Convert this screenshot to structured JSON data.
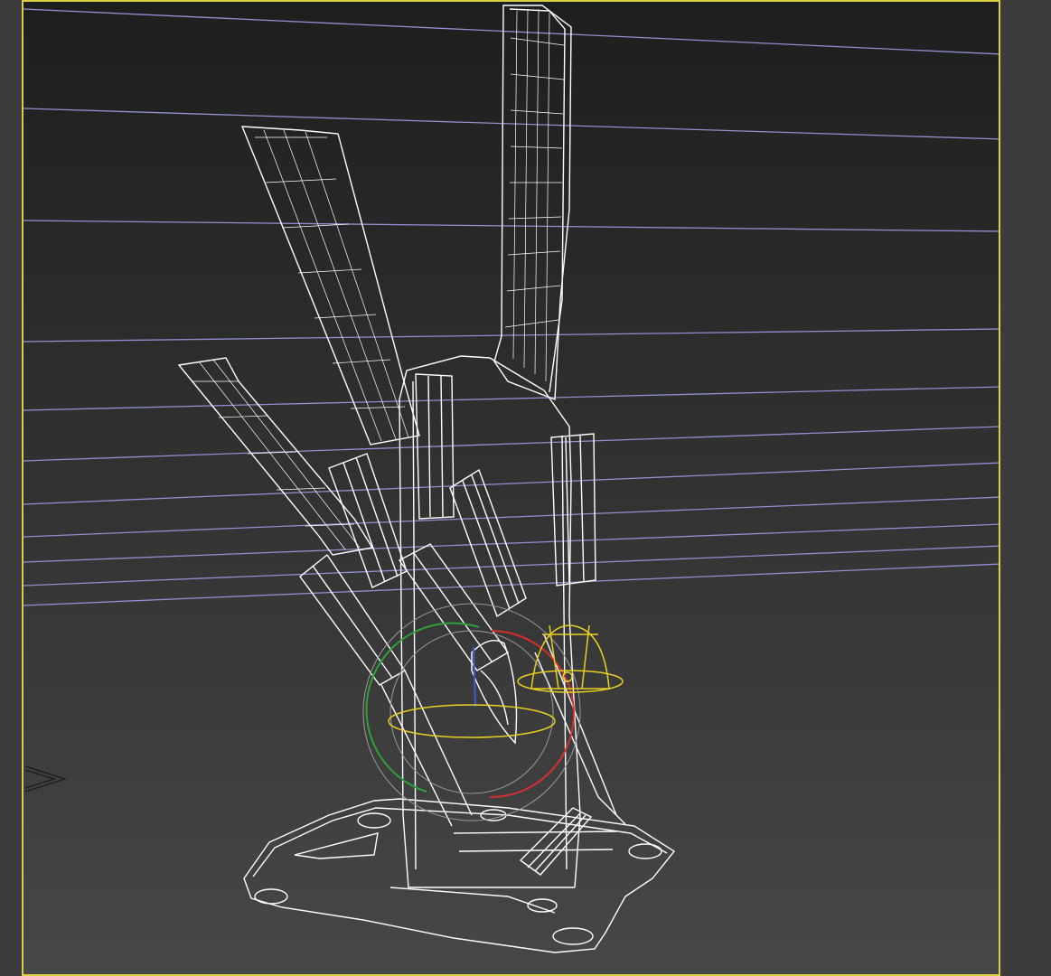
{
  "viewport": {
    "active_border_color": "#d8cf45",
    "background_top": "#1e1e1e",
    "background_bottom": "#474747",
    "wireframe_color": "#ffffff",
    "guide_line_color": "#8f8fd2"
  },
  "gizmo": {
    "rotate_x_color": "#d43030",
    "rotate_y_color": "#2ea03a",
    "rotate_z_color": "#3b5bd6",
    "screen_ring_color": "#9a9a9a",
    "light_color": "#e6d020"
  },
  "icons": {
    "scene_object": "knife-block-wireframe",
    "gizmo": "rotate-gizmo-icon",
    "light": "light-icon",
    "camera": "camera-icon"
  }
}
